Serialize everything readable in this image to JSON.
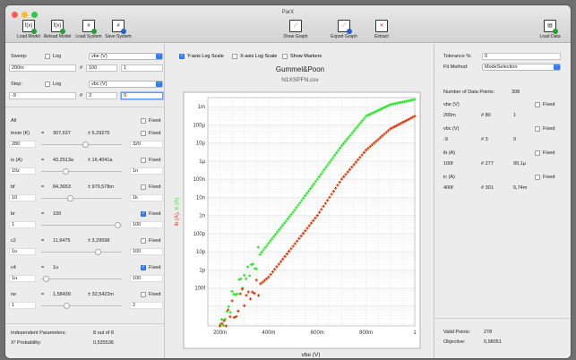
{
  "window": {
    "title": "ParX"
  },
  "toolbar": {
    "load_model": "Load Model",
    "reload_model": "Reload Model",
    "load_system": "Load System",
    "save_system": "Save System",
    "draw_graph": "Draw Graph",
    "export_graph": "Export Graph",
    "extract": "Extract",
    "load_data": "Load Data"
  },
  "sweep": {
    "label": "Sweep:",
    "log_label": "Log",
    "var": "vbe (V)",
    "start": "200m",
    "count_label": "#",
    "count": "100",
    "stop": "1"
  },
  "step": {
    "label": "Step:",
    "log_label": "Log",
    "var": "vbc (V)",
    "start": "-9",
    "count_label": "#",
    "count": "3",
    "stop": "0"
  },
  "params": {
    "all_label": "All",
    "fixed_label": "Fixed",
    "items": [
      {
        "name": "tnom (K)",
        "eq": "=",
        "value": "307,637",
        "pm": "± 5,29275",
        "min": "280",
        "max": "320",
        "fixed": false
      },
      {
        "name": "is (A)",
        "eq": "=",
        "value": "43,2513a",
        "pm": "± 16,4041a",
        "min": "10z",
        "max": "1n",
        "fixed": false
      },
      {
        "name": "bf",
        "eq": "=",
        "value": "84,3653",
        "pm": "± 979,578m",
        "min": "10",
        "max": "1k",
        "fixed": false
      },
      {
        "name": "br",
        "eq": "=",
        "value": "100",
        "pm": "",
        "min": "1",
        "max": "100",
        "fixed": true
      },
      {
        "name": "c2",
        "eq": "=",
        "value": "11,9475",
        "pm": "± 3,29598",
        "min": "1u",
        "max": "100",
        "fixed": false
      },
      {
        "name": "c4",
        "eq": "=",
        "value": "1u",
        "pm": "",
        "min": "1u",
        "max": "100",
        "fixed": true
      },
      {
        "name": "ne",
        "eq": "=",
        "value": "1,58439",
        "pm": "± 32,5422m",
        "min": "1",
        "max": "2",
        "fixed": false
      },
      {
        "name": "nc",
        "eq": "=",
        "value": "2",
        "pm": "",
        "min": "",
        "max": "",
        "fixed": true
      }
    ]
  },
  "footer_left": {
    "indep_label": "Independent Parameters:",
    "indep_value": "8 out of 8",
    "prob_label": "X² Probability:",
    "prob_value": "0,535536"
  },
  "graph_options": {
    "ylog": "Y-axis Log Scale",
    "xlog": "X-axis Log Scale",
    "markers": "Show Markers"
  },
  "chart_data": {
    "type": "scatter",
    "title": "Gummel&Poon",
    "subtitle": "N1XSPFN.csv",
    "xlabel": "vbe (V)",
    "ylabel": "ib (A), ic (A)",
    "ylabel_parts": [
      "ib (A)",
      ", ",
      "ic (A)"
    ],
    "xlim": [
      0.15,
      1.0
    ],
    "ylim_log10": [
      -15.1,
      -2.5
    ],
    "x_ticks": [
      "200m",
      "400m",
      "600m",
      "800m",
      "1"
    ],
    "y_ticks": [
      "1m",
      "100µ",
      "10µ",
      "1µ",
      "100n",
      "10n",
      "1n",
      "100p",
      "10p",
      "1p",
      "100f"
    ],
    "series": [
      {
        "name": "ic (A)",
        "color": "#2ee82e",
        "x": [
          0.2,
          0.3,
          0.4,
          0.5,
          0.6,
          0.7,
          0.8,
          0.9,
          1.0
        ],
        "y": [
          "1e-15",
          "5e-13",
          "3e-11",
          "1.5e-9",
          "1e-7",
          "7e-6",
          "3e-4",
          "1.3e-3",
          "2.5e-3"
        ]
      },
      {
        "name": "ib (A)",
        "color": "#e03a0a",
        "x": [
          0.2,
          0.3,
          0.4,
          0.5,
          0.6,
          0.7,
          0.8,
          0.9,
          1.0
        ],
        "y": [
          "1e-15",
          "3e-14",
          "4e-13",
          "2e-11",
          "1e-9",
          "1e-7",
          "4e-6",
          "6e-5",
          "3e-4"
        ]
      }
    ]
  },
  "right": {
    "tolerance_label": "Tolerance %:",
    "tolerance": "0",
    "fit_label": "Fit Method:",
    "fit_value": "ModeSelection",
    "ndp_label": "Number of Data Points:",
    "ndp_value": "308",
    "fixed_label": "Fixed",
    "vars": [
      {
        "name": "vbe (V)",
        "a": "200m",
        "b": "# 80",
        "c": "1"
      },
      {
        "name": "vbc (V)",
        "a": "-9",
        "b": "# 3",
        "c": "0"
      },
      {
        "name": "ib (A)",
        "a": "100f",
        "b": "# 277",
        "c": "99,1µ"
      },
      {
        "name": "ic (A)",
        "a": "400f",
        "b": "# 301",
        "c": "5,74m"
      }
    ],
    "valid_label": "Valid Points:",
    "valid_value": "278",
    "objective_label": "Objective:",
    "objective_value": "0,98051"
  }
}
